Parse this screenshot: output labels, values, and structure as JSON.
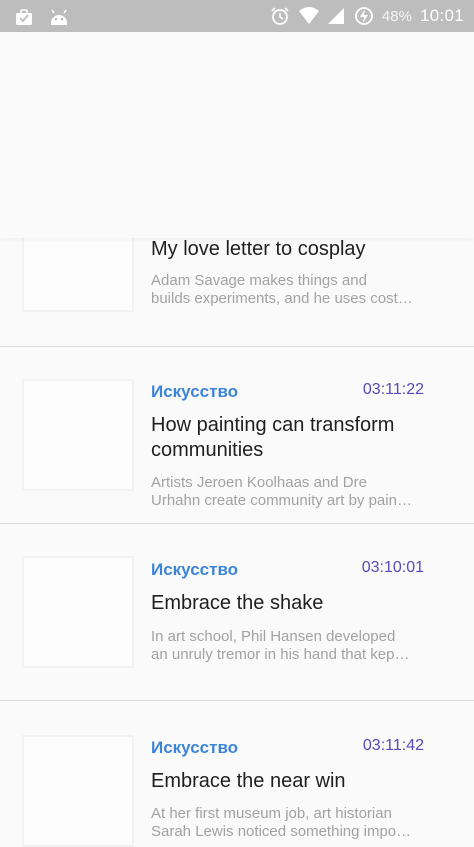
{
  "status_bar": {
    "battery_percent": "48%",
    "time": "10:01",
    "icons": [
      "briefcase-icon",
      "android-icon",
      "alarm-icon",
      "wifi-icon",
      "signal-icon",
      "battery-charging-icon"
    ]
  },
  "items": [
    {
      "title": "My love letter to cosplay",
      "description_line1": "Adam Savage makes things and",
      "description_line2": "builds experiments, and he uses cost…"
    },
    {
      "category": "Искусство",
      "duration": "03:11:22",
      "title_line1": "How painting can transform",
      "title_line2": "communities",
      "description_line1": "Artists Jeroen Koolhaas and Dre",
      "description_line2": "Urhahn create community art by pain…"
    },
    {
      "category": "Искусство",
      "duration": "03:10:01",
      "title_line1": "Embrace the shake",
      "description_line1": "In art school, Phil Hansen developed",
      "description_line2": "an unruly tremor in his hand that kep…"
    },
    {
      "category": "Искусство",
      "duration": "03:11:42",
      "title_line1": "Embrace the near win",
      "description_line1": "At her first museum job, art historian",
      "description_line2": "Sarah Lewis noticed something impo…"
    }
  ]
}
